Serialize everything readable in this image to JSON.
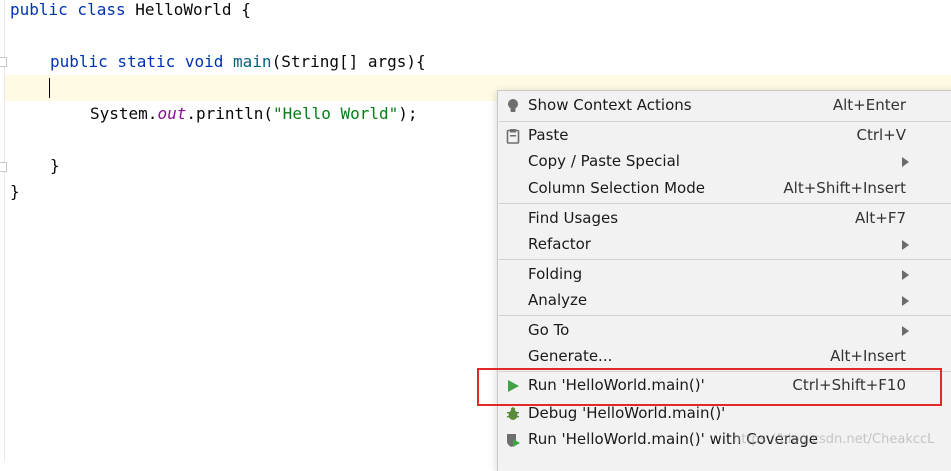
{
  "editor": {
    "lines": {
      "l1": {
        "kw": "public class ",
        "rest": "HelloWorld {"
      },
      "l2": {
        "kw": "public static void ",
        "fn": "main",
        "rest": "(String[] args){"
      },
      "l3": {
        "pre": "System.",
        "field": "out",
        "mid": ".println(",
        "str": "\"Hello World\"",
        "end": ");"
      },
      "l4": {
        "text": "}"
      },
      "l5": {
        "text": "}"
      }
    }
  },
  "context_menu": {
    "show_context_actions": {
      "label": "Show Context Actions",
      "shortcut": "Alt+Enter",
      "icon": "lightbulb-icon"
    },
    "paste": {
      "label": "Paste",
      "shortcut": "Ctrl+V",
      "icon": "clipboard-icon"
    },
    "copy_paste_special": {
      "label": "Copy / Paste Special"
    },
    "column_selection_mode": {
      "label": "Column Selection Mode",
      "shortcut": "Alt+Shift+Insert"
    },
    "find_usages": {
      "label": "Find Usages",
      "shortcut": "Alt+F7"
    },
    "refactor": {
      "label": "Refactor"
    },
    "folding": {
      "label": "Folding"
    },
    "analyze": {
      "label": "Analyze"
    },
    "go_to": {
      "label": "Go To"
    },
    "generate": {
      "label": "Generate...",
      "shortcut": "Alt+Insert"
    },
    "run": {
      "label": "Run 'HelloWorld.main()'",
      "shortcut": "Ctrl+Shift+F10",
      "icon": "run-triangle-icon"
    },
    "debug": {
      "label": "Debug 'HelloWorld.main()'",
      "icon": "debug-bug-icon"
    },
    "run_coverage": {
      "label": "Run 'HelloWorld.main()' with Coverage",
      "icon": "coverage-shield-icon"
    }
  },
  "watermark": "https://blog.csdn.net/CheakccL",
  "colors": {
    "highlight_border": "#e02a2a",
    "run_icon": "#3fa345",
    "menu_bg": "#f2f2f2"
  }
}
